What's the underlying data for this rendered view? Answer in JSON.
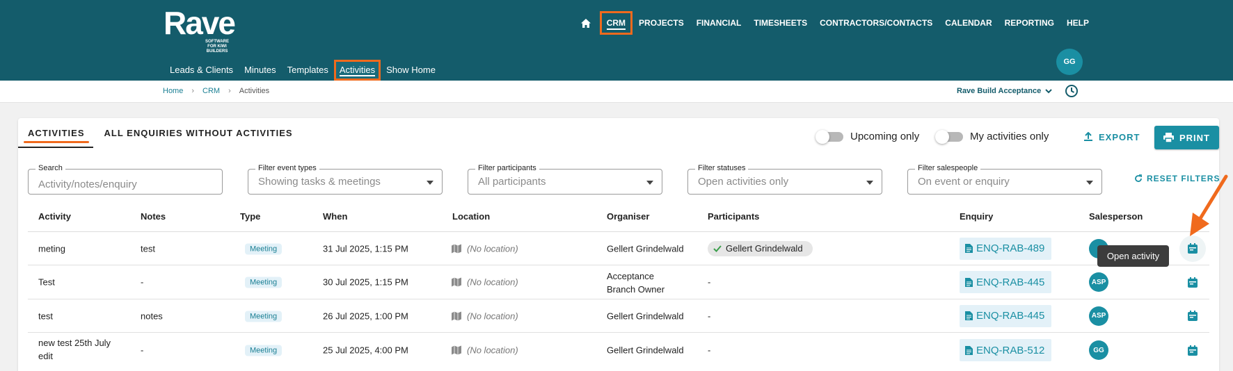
{
  "header": {
    "logo_word": "Rave",
    "logo_tagline": "SOFTWARE FOR KIWI BUILDERS",
    "top_nav": [
      "CRM",
      "PROJECTS",
      "FINANCIAL",
      "TIMESHEETS",
      "CONTRACTORS/CONTACTS",
      "CALENDAR",
      "REPORTING",
      "HELP"
    ],
    "active_top": "CRM",
    "sub_nav": [
      "Leads & Clients",
      "Minutes",
      "Templates",
      "Activities",
      "Show Home"
    ],
    "active_sub": "Activities",
    "user_initials": "GG"
  },
  "breadcrumb": {
    "home": "Home",
    "crm": "CRM",
    "current": "Activities"
  },
  "org_select": "Rave Build Acceptance",
  "tabs": [
    "ACTIVITIES",
    "ALL ENQUIRIES WITHOUT ACTIVITIES"
  ],
  "toggles": {
    "upcoming": "Upcoming only",
    "mine": "My activities only"
  },
  "actions": {
    "export": "EXPORT",
    "print": "PRINT",
    "reset": "RESET FILTERS"
  },
  "filters": {
    "search_label": "Search",
    "search_placeholder": "Activity/notes/enquiry",
    "event_label": "Filter event types",
    "event_value": "Showing tasks & meetings",
    "participants_label": "Filter participants",
    "participants_value": "All participants",
    "statuses_label": "Filter statuses",
    "statuses_value": "Open activities only",
    "salespeople_label": "Filter salespeople",
    "salespeople_value": "On event or enquiry"
  },
  "table": {
    "columns": [
      "Activity",
      "Notes",
      "Type",
      "When",
      "Location",
      "Organiser",
      "Participants",
      "Enquiry",
      "Salesperson"
    ],
    "rows": [
      {
        "activity": "meting",
        "activity2": "",
        "notes": "test",
        "type": "Meeting",
        "when": "31 Jul 2025, 1:15 PM",
        "location": "(No location)",
        "organiser": "Gellert Grindelwald",
        "organiser2": "",
        "participant": "Gellert Grindelwald",
        "enquiry": "ENQ-RAB-489",
        "salesperson": ""
      },
      {
        "activity": "Test",
        "activity2": "",
        "notes": "-",
        "type": "Meeting",
        "when": "30 Jul 2025, 1:15 PM",
        "location": "(No location)",
        "organiser": "Acceptance",
        "organiser2": "Branch Owner",
        "participant": "-",
        "enquiry": "ENQ-RAB-445",
        "salesperson": "ASP"
      },
      {
        "activity": "test",
        "activity2": "",
        "notes": "notes",
        "type": "Meeting",
        "when": "26 Jul 2025, 1:00 PM",
        "location": "(No location)",
        "organiser": "Gellert Grindelwald",
        "organiser2": "",
        "participant": "-",
        "enquiry": "ENQ-RAB-445",
        "salesperson": "ASP"
      },
      {
        "activity": "new test 25th July",
        "activity2": "edit",
        "notes": "-",
        "type": "Meeting",
        "when": "25 Jul 2025, 4:00 PM",
        "location": "(No location)",
        "organiser": "Gellert Grindelwald",
        "organiser2": "",
        "participant": "-",
        "enquiry": "ENQ-RAB-512",
        "salesperson": "GG"
      }
    ]
  },
  "tooltip": "Open activity",
  "colors": {
    "header_bg": "#145c6b",
    "accent": "#1a8fa3",
    "highlight": "#f06a1d"
  }
}
